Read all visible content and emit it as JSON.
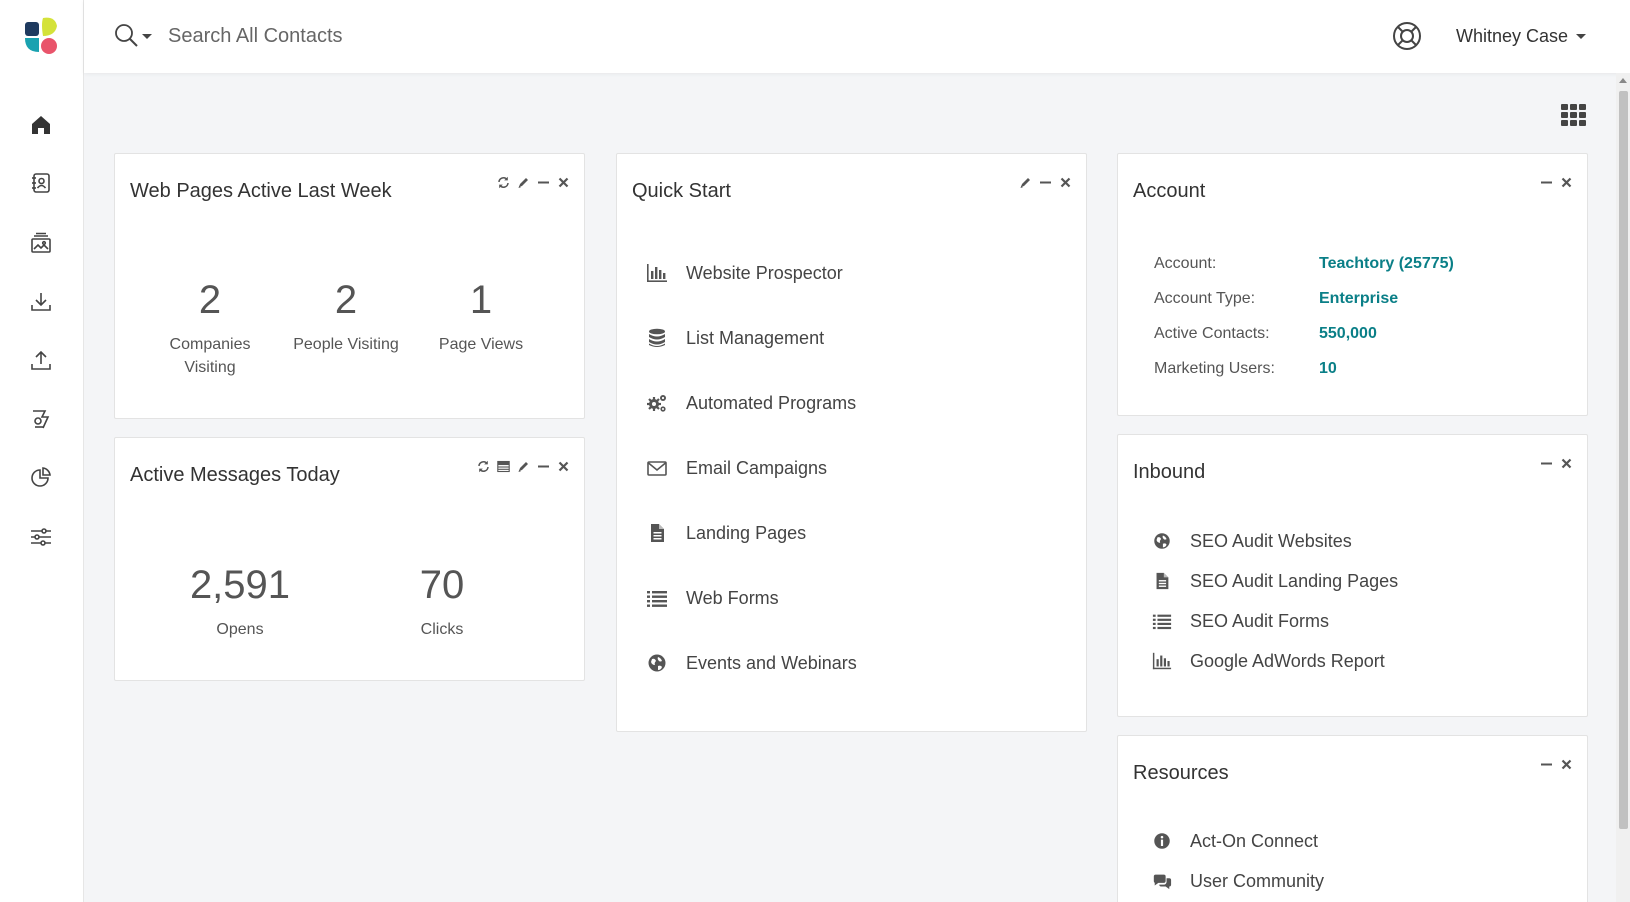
{
  "header": {
    "search_placeholder": "Search All Contacts",
    "user_name": "Whitney Case"
  },
  "nav": {
    "items": [
      "home-icon",
      "contacts-icon",
      "media-icon",
      "download-icon",
      "upload-icon",
      "automation-icon",
      "reports-icon",
      "settings-icon"
    ]
  },
  "widgets": {
    "web_pages": {
      "title": "Web Pages Active Last Week",
      "stats": [
        {
          "value": "2",
          "label_line1": "Companies",
          "label_line2": "Visiting"
        },
        {
          "value": "2",
          "label_line1": "People Visiting",
          "label_line2": ""
        },
        {
          "value": "1",
          "label_line1": "Page Views",
          "label_line2": ""
        }
      ]
    },
    "active_messages": {
      "title": "Active Messages Today",
      "stats": [
        {
          "value": "2,591",
          "label": "Opens"
        },
        {
          "value": "70",
          "label": "Clicks"
        }
      ]
    },
    "quick_start": {
      "title": "Quick Start",
      "items": [
        {
          "label": "Website Prospector",
          "icon": "bar-chart-icon"
        },
        {
          "label": "List Management",
          "icon": "database-icon"
        },
        {
          "label": "Automated Programs",
          "icon": "gears-icon"
        },
        {
          "label": "Email Campaigns",
          "icon": "envelope-icon"
        },
        {
          "label": "Landing Pages",
          "icon": "document-icon"
        },
        {
          "label": "Web Forms",
          "icon": "list-icon"
        },
        {
          "label": "Events and Webinars",
          "icon": "globe-icon"
        }
      ]
    },
    "account": {
      "title": "Account",
      "rows": [
        {
          "key": "Account:",
          "value": "Teachtory (25775)"
        },
        {
          "key": "Account Type:",
          "value": "Enterprise"
        },
        {
          "key": "Active Contacts:",
          "value": "550,000"
        },
        {
          "key": "Marketing Users:",
          "value": "10"
        }
      ]
    },
    "inbound": {
      "title": "Inbound",
      "items": [
        {
          "label": "SEO Audit Websites",
          "icon": "globe-icon"
        },
        {
          "label": "SEO Audit Landing Pages",
          "icon": "document-icon"
        },
        {
          "label": "SEO Audit Forms",
          "icon": "list-icon"
        },
        {
          "label": "Google AdWords Report",
          "icon": "bar-chart-icon"
        }
      ]
    },
    "resources": {
      "title": "Resources",
      "items": [
        {
          "label": "Act-On Connect",
          "icon": "info-icon"
        },
        {
          "label": "User Community",
          "icon": "comments-icon"
        }
      ]
    }
  },
  "colors": {
    "accent": "#0a7f87",
    "logo_yellow": "#d4e23a",
    "logo_teal": "#1aa2b0",
    "logo_navy": "#1f3a5f",
    "logo_pink": "#e9546b"
  }
}
